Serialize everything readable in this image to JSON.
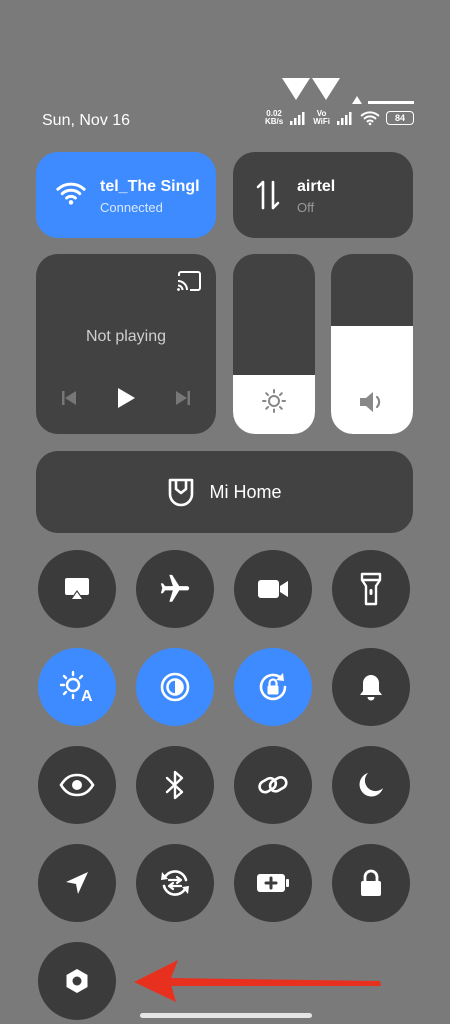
{
  "status_bar": {
    "date": "Sun, Nov 16",
    "net_speed_value": "0.02",
    "net_speed_unit": "KB/s",
    "volte_top": "Vo",
    "volte_bottom": "WiFi",
    "battery": "84"
  },
  "wifi_tile": {
    "name": "tel_The Singl",
    "status": "Connected",
    "icon": "wifi-icon"
  },
  "data_tile": {
    "name": "airtel",
    "status": "Off",
    "icon": "data-transfer-icon"
  },
  "media_tile": {
    "status": "Not playing",
    "icons": [
      "cast-icon",
      "previous-icon",
      "play-icon",
      "next-icon"
    ]
  },
  "brightness_slider": {
    "level": 0.33,
    "icon": "brightness-icon"
  },
  "volume_slider": {
    "level": 0.6,
    "icon": "volume-icon"
  },
  "mi_home": {
    "label": "Mi Home",
    "icon": "mi-home-icon"
  },
  "toggles": [
    {
      "name": "screen-cast",
      "icon": "cast-screen-icon",
      "on": false
    },
    {
      "name": "airplane-mode",
      "icon": "airplane-icon",
      "on": false
    },
    {
      "name": "screen-recorder",
      "icon": "video-camera-icon",
      "on": false
    },
    {
      "name": "flashlight",
      "icon": "flashlight-icon",
      "on": false
    },
    {
      "name": "auto-brightness",
      "icon": "auto-brightness-icon",
      "on": true
    },
    {
      "name": "dark-mode",
      "icon": "contrast-icon",
      "on": true
    },
    {
      "name": "rotation-lock",
      "icon": "rotation-lock-icon",
      "on": true
    },
    {
      "name": "sound",
      "icon": "bell-icon",
      "on": false
    },
    {
      "name": "reading-mode",
      "icon": "eye-icon",
      "on": false
    },
    {
      "name": "bluetooth",
      "icon": "bluetooth-icon",
      "on": false
    },
    {
      "name": "link",
      "icon": "link-icon",
      "on": false
    },
    {
      "name": "do-not-disturb",
      "icon": "moon-icon",
      "on": false
    },
    {
      "name": "location",
      "icon": "location-arrow-icon",
      "on": false
    },
    {
      "name": "sync",
      "icon": "sync-icon",
      "on": false
    },
    {
      "name": "battery-saver",
      "icon": "battery-plus-icon",
      "on": false
    },
    {
      "name": "lock-screen",
      "icon": "lock-icon",
      "on": false
    },
    {
      "name": "settings",
      "icon": "hexagon-settings-icon",
      "on": false
    }
  ],
  "annotation": {
    "arrow_color": "#e8301e",
    "icon": "red-arrow-icon"
  },
  "colors": {
    "accent": "#3d8bff",
    "background": "#7a7a7a",
    "tile": "#424242",
    "toggle_off": "#3b3b3b"
  }
}
